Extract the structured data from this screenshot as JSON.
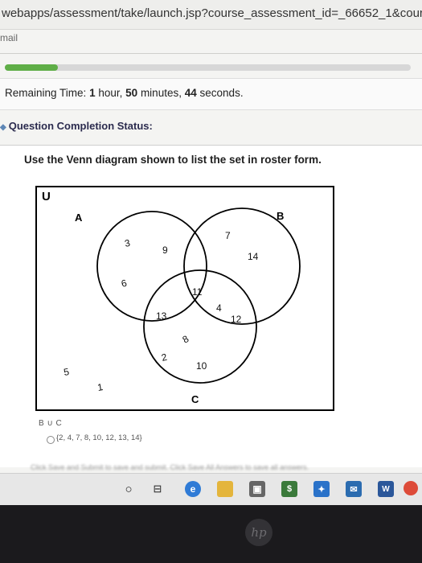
{
  "browser": {
    "url": "webapps/assessment/take/launch.jsp?course_assessment_id=_66652_1&course_id=_"
  },
  "bookmarks": {
    "first": "mail"
  },
  "progress": {
    "fraction": 0.13,
    "color": "#5fae47"
  },
  "timer": {
    "label": "Remaining Time:",
    "hours": "1",
    "hours_unit": "hour,",
    "minutes": "50",
    "minutes_unit": "minutes,",
    "seconds": "44",
    "seconds_unit": "seconds."
  },
  "status": {
    "title": "Question Completion Status:"
  },
  "question": {
    "text": "Use the Venn diagram shown to list the set in roster form.",
    "venn": {
      "labels": {
        "universe": "U",
        "a": "A",
        "b": "B",
        "c": "C"
      },
      "numbers": [
        "3",
        "9",
        "6",
        "7",
        "14",
        "11",
        "13",
        "4",
        "12",
        "8",
        "2",
        "10",
        "5",
        "1"
      ]
    },
    "answer_label": "B ∪ C",
    "answer_option": "{2, 4, 7, 8, 10, 12, 13, 14}"
  },
  "footer": {
    "blurred_text": "Click Save and Submit to save and submit. Click Save All Answers to save all answers."
  },
  "taskbar": {
    "icons": [
      "search-icon",
      "task-view-icon",
      "edge-icon",
      "file-explorer-icon",
      "store-icon",
      "app-icon",
      "dropbox-icon",
      "mail-icon",
      "word-icon",
      "chrome-icon"
    ]
  },
  "bezel": {
    "logo": "hp"
  }
}
